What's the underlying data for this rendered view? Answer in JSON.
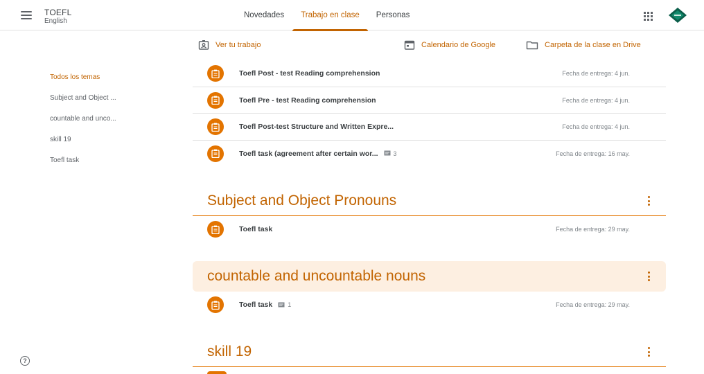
{
  "header": {
    "class_name": "TOEFL",
    "section": "English",
    "tabs": [
      {
        "label": "Novedades"
      },
      {
        "label": "Trabajo en clase"
      },
      {
        "label": "Personas"
      }
    ]
  },
  "sidebar": {
    "items": [
      {
        "label": "Todos los temas"
      },
      {
        "label": "Subject and Object ..."
      },
      {
        "label": "countable and unco..."
      },
      {
        "label": "skill 19"
      },
      {
        "label": "Toefl task"
      }
    ]
  },
  "toolbar": {
    "view_work": "Ver tu trabajo",
    "calendar": "Calendario de Google",
    "drive_folder": "Carpeta de la clase en Drive"
  },
  "assignments": [
    {
      "title": "Toefl Post - test Reading comprehension",
      "due": "Fecha de entrega: 4 jun."
    },
    {
      "title": "Toefl Pre - test Reading comprehension",
      "due": "Fecha de entrega: 4 jun."
    },
    {
      "title": "Toefl Post-test Structure and Written Expre...",
      "due": "Fecha de entrega: 4 jun."
    },
    {
      "title": "Toefl task (agreement after certain wor...",
      "comments": "3",
      "due": "Fecha de entrega: 16 may."
    }
  ],
  "topics": [
    {
      "title": "Subject and Object Pronouns",
      "items": [
        {
          "title": "Toefl task",
          "due": "Fecha de entrega: 29 may."
        }
      ]
    },
    {
      "title": "countable and uncountable nouns",
      "items": [
        {
          "title": "Toefl task",
          "comments": "1",
          "due": "Fecha de entrega: 29 may."
        }
      ]
    },
    {
      "title": "skill 19",
      "items": []
    }
  ],
  "colors": {
    "accent": "#c26401",
    "assignment_icon": "#e37400",
    "highlight_bg": "#fdefe1",
    "avatar_bg": "#0b5e4a"
  },
  "icons": {
    "menu": "hamburger-menu-icon",
    "apps": "apps-grid-icon",
    "assignment": "assignment-clipboard-icon",
    "comment": "comment-icon",
    "view_work": "id-badge-icon",
    "calendar": "calendar-icon",
    "drive": "folder-icon",
    "more": "more-vert-icon",
    "help": "help-icon"
  }
}
